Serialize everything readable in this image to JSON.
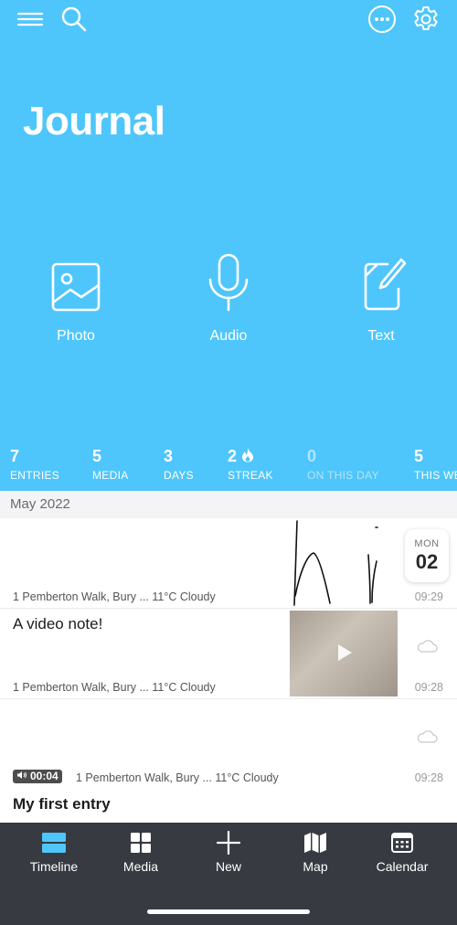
{
  "header": {
    "title": "Journal",
    "colors": {
      "background": "#4fc6fb",
      "foreground": "#ffffff"
    },
    "icons": [
      "menu-icon",
      "search-icon",
      "more-icon",
      "settings-icon"
    ]
  },
  "quick_actions": [
    {
      "label": "Photo",
      "icon": "photo-icon"
    },
    {
      "label": "Audio",
      "icon": "microphone-icon"
    },
    {
      "label": "Text",
      "icon": "compose-icon"
    }
  ],
  "stats": [
    {
      "value": "7",
      "label": "ENTRIES"
    },
    {
      "value": "5",
      "label": "MEDIA"
    },
    {
      "value": "3",
      "label": "DAYS"
    },
    {
      "value": "2",
      "label": "STREAK",
      "icon": "flame-icon"
    },
    {
      "value": "0",
      "label": "ON THIS DAY"
    },
    {
      "value": "5",
      "label": "THIS WE"
    }
  ],
  "timeline": {
    "month": "May 2022",
    "date_badge": {
      "weekday": "MON",
      "day": "02"
    },
    "entries": [
      {
        "meta": "1 Pemberton Walk, Bury ... 11°C Cloudy",
        "time": "09:29"
      },
      {
        "title": "A video note!",
        "meta": "1 Pemberton Walk, Bury ... 11°C Cloudy",
        "time": "09:28",
        "icon": "cloud-icon"
      },
      {
        "audio_duration": "00:04",
        "meta": "1 Pemberton Walk, Bury ... 11°C Cloudy",
        "time": "09:28",
        "icon": "cloud-icon"
      },
      {
        "title": "My first entry"
      }
    ]
  },
  "tabbar": {
    "active": "Timeline",
    "active_color": "#4fc6fb",
    "tabs": [
      {
        "label": "Timeline",
        "icon": "timeline-icon"
      },
      {
        "label": "Media",
        "icon": "grid-icon"
      },
      {
        "label": "New",
        "icon": "plus-icon"
      },
      {
        "label": "Map",
        "icon": "map-icon"
      },
      {
        "label": "Calendar",
        "icon": "calendar-icon"
      }
    ]
  }
}
